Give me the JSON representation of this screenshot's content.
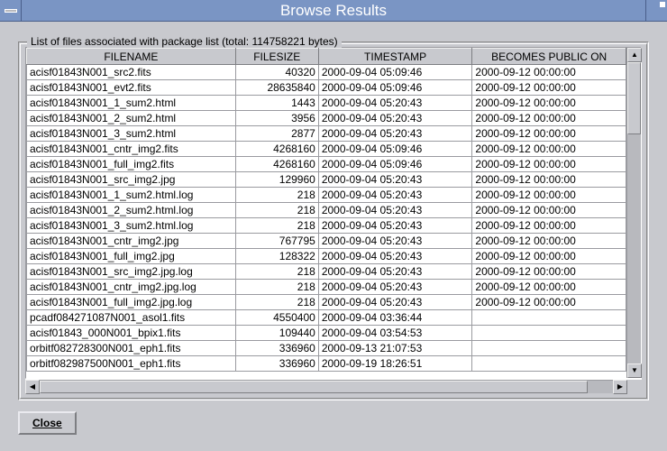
{
  "title": "Browse Results",
  "legend": "List of files associated with package list (total: 114758221 bytes)",
  "close_label": "Close",
  "columns": [
    "FILENAME",
    "FILESIZE",
    "TIMESTAMP",
    "BECOMES PUBLIC ON"
  ],
  "rows": [
    {
      "filename": "acisf01843N001_src2.fits",
      "filesize": "40320",
      "timestamp": "2000-09-04 05:09:46",
      "public": "2000-09-12 00:00:00"
    },
    {
      "filename": "acisf01843N001_evt2.fits",
      "filesize": "28635840",
      "timestamp": "2000-09-04 05:09:46",
      "public": "2000-09-12 00:00:00"
    },
    {
      "filename": "acisf01843N001_1_sum2.html",
      "filesize": "1443",
      "timestamp": "2000-09-04 05:20:43",
      "public": "2000-09-12 00:00:00"
    },
    {
      "filename": "acisf01843N001_2_sum2.html",
      "filesize": "3956",
      "timestamp": "2000-09-04 05:20:43",
      "public": "2000-09-12 00:00:00"
    },
    {
      "filename": "acisf01843N001_3_sum2.html",
      "filesize": "2877",
      "timestamp": "2000-09-04 05:20:43",
      "public": "2000-09-12 00:00:00"
    },
    {
      "filename": "acisf01843N001_cntr_img2.fits",
      "filesize": "4268160",
      "timestamp": "2000-09-04 05:09:46",
      "public": "2000-09-12 00:00:00"
    },
    {
      "filename": "acisf01843N001_full_img2.fits",
      "filesize": "4268160",
      "timestamp": "2000-09-04 05:09:46",
      "public": "2000-09-12 00:00:00"
    },
    {
      "filename": "acisf01843N001_src_img2.jpg",
      "filesize": "129960",
      "timestamp": "2000-09-04 05:20:43",
      "public": "2000-09-12 00:00:00"
    },
    {
      "filename": "acisf01843N001_1_sum2.html.log",
      "filesize": "218",
      "timestamp": "2000-09-04 05:20:43",
      "public": "2000-09-12 00:00:00"
    },
    {
      "filename": "acisf01843N001_2_sum2.html.log",
      "filesize": "218",
      "timestamp": "2000-09-04 05:20:43",
      "public": "2000-09-12 00:00:00"
    },
    {
      "filename": "acisf01843N001_3_sum2.html.log",
      "filesize": "218",
      "timestamp": "2000-09-04 05:20:43",
      "public": "2000-09-12 00:00:00"
    },
    {
      "filename": "acisf01843N001_cntr_img2.jpg",
      "filesize": "767795",
      "timestamp": "2000-09-04 05:20:43",
      "public": "2000-09-12 00:00:00"
    },
    {
      "filename": "acisf01843N001_full_img2.jpg",
      "filesize": "128322",
      "timestamp": "2000-09-04 05:20:43",
      "public": "2000-09-12 00:00:00"
    },
    {
      "filename": "acisf01843N001_src_img2.jpg.log",
      "filesize": "218",
      "timestamp": "2000-09-04 05:20:43",
      "public": "2000-09-12 00:00:00"
    },
    {
      "filename": "acisf01843N001_cntr_img2.jpg.log",
      "filesize": "218",
      "timestamp": "2000-09-04 05:20:43",
      "public": "2000-09-12 00:00:00"
    },
    {
      "filename": "acisf01843N001_full_img2.jpg.log",
      "filesize": "218",
      "timestamp": "2000-09-04 05:20:43",
      "public": "2000-09-12 00:00:00"
    },
    {
      "filename": "pcadf084271087N001_asol1.fits",
      "filesize": "4550400",
      "timestamp": "2000-09-04 03:36:44",
      "public": ""
    },
    {
      "filename": "acisf01843_000N001_bpix1.fits",
      "filesize": "109440",
      "timestamp": "2000-09-04 03:54:53",
      "public": ""
    },
    {
      "filename": "orbitf082728300N001_eph1.fits",
      "filesize": "336960",
      "timestamp": "2000-09-13 21:07:53",
      "public": ""
    },
    {
      "filename": "orbitf082987500N001_eph1.fits",
      "filesize": "336960",
      "timestamp": "2000-09-19 18:26:51",
      "public": ""
    }
  ]
}
